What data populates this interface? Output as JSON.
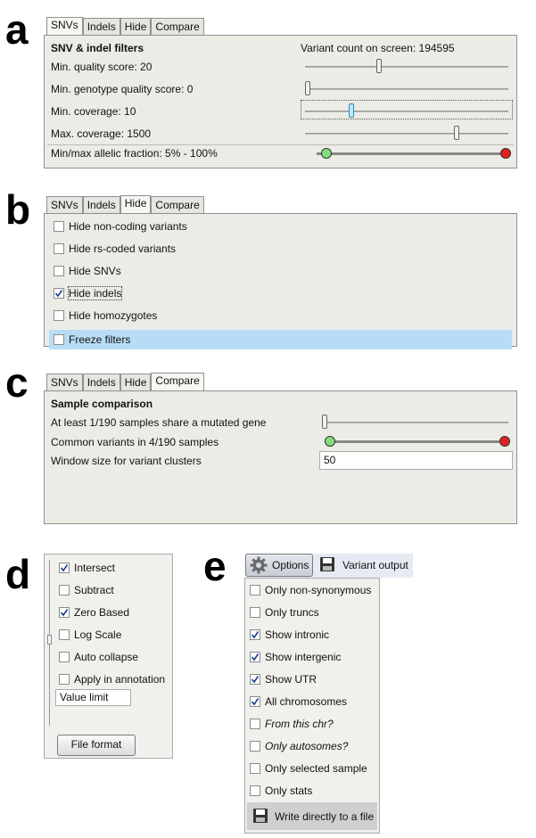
{
  "panel_letters": [
    "a",
    "b",
    "c",
    "d",
    "e"
  ],
  "tab_labels": [
    "SNVs",
    "Indels",
    "Hide",
    "Compare"
  ],
  "panel_a": {
    "active_tab": "SNVs",
    "heading": "SNV & indel filters",
    "variant_count": "Variant count on screen: 194595",
    "rows": [
      {
        "label": "Min. quality score: 20",
        "slider_level": 0.36
      },
      {
        "label": "Min. genotype quality score: 0",
        "slider_level": 0.0
      },
      {
        "label": "Min. coverage: 10",
        "slider_level": 0.22
      },
      {
        "label": "Max. coverage: 1500",
        "slider_level": 0.75
      }
    ],
    "allelic_fraction": {
      "label": "Min/max allelic fraction: 5% - 100%",
      "min": 0.05,
      "max": 1.0
    }
  },
  "panel_b": {
    "active_tab": "Hide",
    "items": [
      {
        "label": "Hide non-coding variants",
        "checked": false
      },
      {
        "label": "Hide rs-coded variants",
        "checked": false
      },
      {
        "label": "Hide SNVs",
        "checked": false
      },
      {
        "label": "Hide indels",
        "checked": true
      },
      {
        "label": "Hide homozygotes",
        "checked": false
      },
      {
        "label": "Freeze filters",
        "checked": false
      }
    ]
  },
  "panel_c": {
    "active_tab": "Compare",
    "heading": "Sample comparison",
    "shared_gene_label": "At least 1/190 samples share a mutated gene",
    "common_variants_label": "Common variants in 4/190 samples",
    "window_label": "Window size for variant clusters",
    "window_value": "50"
  },
  "panel_d": {
    "items": [
      {
        "label": "Intersect",
        "checked": true
      },
      {
        "label": "Subtract",
        "checked": false
      },
      {
        "label": "Zero Based",
        "checked": true
      },
      {
        "label": "Log Scale",
        "checked": false
      },
      {
        "label": "Auto collapse",
        "checked": false
      },
      {
        "label": "Apply in annotation",
        "checked": false
      }
    ],
    "value_limit": "Value limit",
    "file_format_button": "File format"
  },
  "panel_e": {
    "options_button": "Options",
    "variant_output_button": "Variant output",
    "items": [
      {
        "label": "Only non-synonymous",
        "checked": false,
        "italic": false
      },
      {
        "label": "Only truncs",
        "checked": false,
        "italic": false
      },
      {
        "label": "Show intronic",
        "checked": true,
        "italic": false
      },
      {
        "label": "Show intergenic",
        "checked": true,
        "italic": false
      },
      {
        "label": "Show UTR",
        "checked": true,
        "italic": false
      },
      {
        "label": "All chromosomes",
        "checked": true,
        "italic": false
      },
      {
        "label": "From this chr?",
        "checked": false,
        "italic": true
      },
      {
        "label": "Only autosomes?",
        "checked": false,
        "italic": true
      },
      {
        "label": "Only selected sample",
        "checked": false,
        "italic": false
      },
      {
        "label": "Only stats",
        "checked": false,
        "italic": false
      }
    ],
    "write_file_label": "Write directly to a file"
  },
  "colors": {
    "panel_bg": "#ecece6",
    "highlight_row": "#b8dcf6",
    "range_min_dot": "#7fe07f",
    "range_max_dot": "#e02020",
    "check_mark": "#1a3d8f"
  }
}
